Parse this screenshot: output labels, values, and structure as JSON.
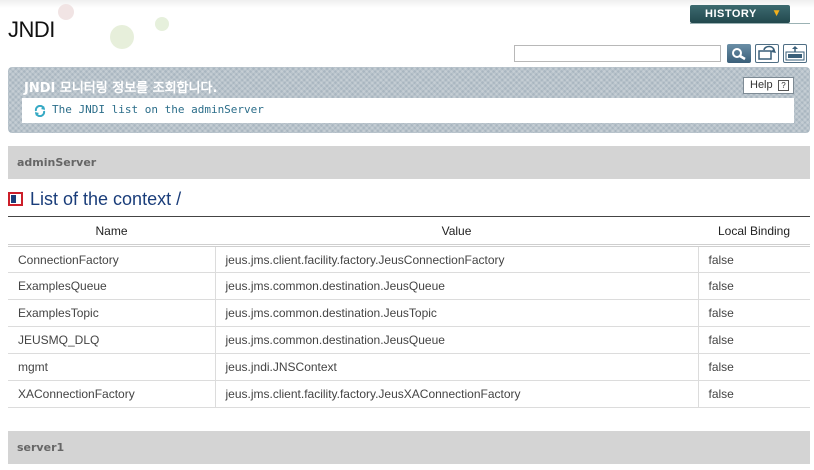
{
  "app": {
    "title": "JNDI"
  },
  "header": {
    "history_label": "HISTORY",
    "search_value": ""
  },
  "icons": {
    "search": "search-icon",
    "refresh": "refresh-icon",
    "xml": "xml-export-icon"
  },
  "info": {
    "title": "JNDI 모니터링 정보를 조회합니다.",
    "help_label": "Help",
    "help_icon_glyph": "?",
    "subtitle": "The JNDI list on the adminServer"
  },
  "servers": [
    "adminServer",
    "server1"
  ],
  "context": {
    "title": "List of the context /",
    "columns": [
      "Name",
      "Value",
      "Local Binding"
    ],
    "rows": [
      [
        "ConnectionFactory",
        "jeus.jms.client.facility.factory.JeusConnectionFactory",
        "false"
      ],
      [
        "ExamplesQueue",
        "jeus.jms.common.destination.JeusQueue",
        "false"
      ],
      [
        "ExamplesTopic",
        "jeus.jms.common.destination.JeusTopic",
        "false"
      ],
      [
        "JEUSMQ_DLQ",
        "jeus.jms.common.destination.JeusQueue",
        "false"
      ],
      [
        "mgmt",
        "jeus.jndi.JNSContext",
        "false"
      ],
      [
        "XAConnectionFactory",
        "jeus.jms.client.facility.factory.JeusXAConnectionFactory",
        "false"
      ]
    ]
  },
  "colors": {
    "panel": "#a9b6c0",
    "title_blue": "#1a3d7a",
    "history_bg": "#2f5a60",
    "accent_orange": "#f3b01c"
  }
}
